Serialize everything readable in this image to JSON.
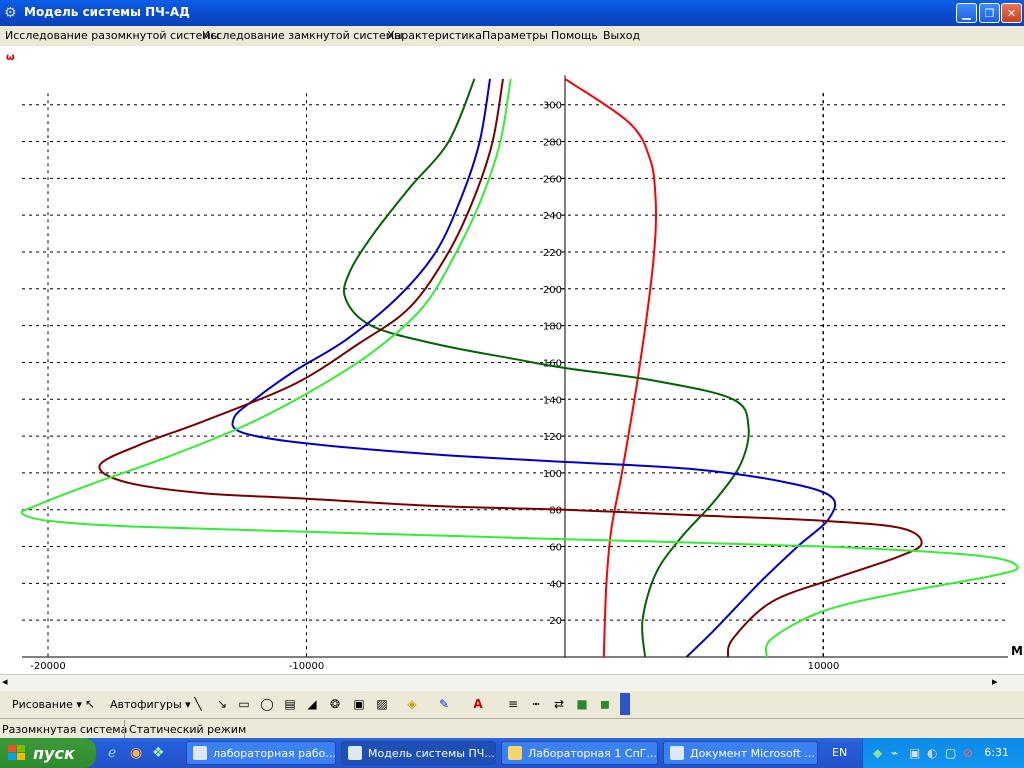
{
  "window": {
    "title": "Модель системы ПЧ-АД",
    "icon": "gear-icon"
  },
  "menu": [
    "Исследование разомкнутой системы",
    "Исследование замкнутой системы",
    "Характеристика",
    "Параметры",
    "Помощь",
    "Выход"
  ],
  "chart_data": {
    "type": "line",
    "ylabel": "ω",
    "xlabel": "M",
    "x_ticks": [
      "-20000",
      "-10000",
      "10000"
    ],
    "y_ticks": [
      "300",
      "280",
      "260",
      "240",
      "220",
      "200",
      "180",
      "160",
      "140",
      "120",
      "100",
      "80",
      "60",
      "40",
      "20"
    ],
    "xlim": [
      -21000,
      17500
    ],
    "ylim": [
      0,
      316
    ],
    "grid": true,
    "series": [
      {
        "color": "#ff0000",
        "points": [
          [
            0,
            314
          ],
          [
            2500,
            290
          ],
          [
            3300,
            270
          ],
          [
            3500,
            250
          ],
          [
            3500,
            230
          ],
          [
            3300,
            200
          ],
          [
            2800,
            150
          ],
          [
            2200,
            100
          ],
          [
            1800,
            70
          ],
          [
            1600,
            40
          ],
          [
            1500,
            0
          ]
        ]
      },
      {
        "color": "#006400",
        "points": [
          [
            -3500,
            314
          ],
          [
            -4500,
            280
          ],
          [
            -6000,
            255
          ],
          [
            -7400,
            230
          ],
          [
            -8300,
            210
          ],
          [
            -8500,
            195
          ],
          [
            -7500,
            180
          ],
          [
            -5000,
            170
          ],
          [
            -2000,
            162
          ],
          [
            0,
            157
          ],
          [
            3500,
            150
          ],
          [
            6500,
            140
          ],
          [
            7100,
            125
          ],
          [
            6800,
            105
          ],
          [
            5800,
            85
          ],
          [
            4500,
            65
          ],
          [
            3500,
            45
          ],
          [
            3000,
            20
          ],
          [
            3100,
            0
          ]
        ]
      },
      {
        "color": "#0000cc",
        "points": [
          [
            -2900,
            314
          ],
          [
            -3300,
            280
          ],
          [
            -4000,
            250
          ],
          [
            -5000,
            220
          ],
          [
            -6500,
            195
          ],
          [
            -8500,
            172
          ],
          [
            -10500,
            155
          ],
          [
            -12000,
            140
          ],
          [
            -12800,
            130
          ],
          [
            -12500,
            122
          ],
          [
            -10000,
            116
          ],
          [
            -5000,
            110
          ],
          [
            0,
            106
          ],
          [
            5000,
            102
          ],
          [
            8500,
            95
          ],
          [
            10300,
            87
          ],
          [
            10200,
            75
          ],
          [
            9000,
            60
          ],
          [
            7500,
            40
          ],
          [
            5800,
            15
          ],
          [
            4700,
            0
          ]
        ]
      },
      {
        "color": "#7a0000",
        "points": [
          [
            -2400,
            314
          ],
          [
            -2800,
            280
          ],
          [
            -3500,
            250
          ],
          [
            -4500,
            220
          ],
          [
            -6000,
            190
          ],
          [
            -8000,
            170
          ],
          [
            -10500,
            148
          ],
          [
            -14000,
            128
          ],
          [
            -16500,
            115
          ],
          [
            -18000,
            104
          ],
          [
            -17000,
            95
          ],
          [
            -14000,
            89
          ],
          [
            -10000,
            86
          ],
          [
            -5000,
            82
          ],
          [
            0,
            80
          ],
          [
            5000,
            77
          ],
          [
            10000,
            74
          ],
          [
            13000,
            70
          ],
          [
            13800,
            62
          ],
          [
            13000,
            55
          ],
          [
            10500,
            43
          ],
          [
            8000,
            30
          ],
          [
            6500,
            10
          ],
          [
            6300,
            0
          ]
        ]
      },
      {
        "color": "#33ee33",
        "points": [
          [
            -2100,
            314
          ],
          [
            -2500,
            280
          ],
          [
            -3200,
            250
          ],
          [
            -4200,
            220
          ],
          [
            -5500,
            190
          ],
          [
            -7500,
            165
          ],
          [
            -10000,
            143
          ],
          [
            -12500,
            125
          ],
          [
            -15500,
            108
          ],
          [
            -18500,
            93
          ],
          [
            -20500,
            82
          ],
          [
            -21000,
            78
          ],
          [
            -20000,
            74
          ],
          [
            -17000,
            71
          ],
          [
            -10000,
            68
          ],
          [
            0,
            64
          ],
          [
            10000,
            60
          ],
          [
            16000,
            55
          ],
          [
            17500,
            49
          ],
          [
            16500,
            44
          ],
          [
            13000,
            35
          ],
          [
            10000,
            25
          ],
          [
            8000,
            10
          ],
          [
            7800,
            0
          ]
        ]
      }
    ]
  },
  "hscroll": {
    "left_arrow": "◂",
    "right_arrow": "▸"
  },
  "drawing_toolbar": {
    "draw_label": "Рисование ▾",
    "autoshapes_label": "Автофигуры ▾"
  },
  "status": {
    "left": "Разомкнутая система",
    "right": "Статический режим"
  },
  "taskbar": {
    "start_label": "пуск",
    "tasks": [
      {
        "label": "лабораторная рабо...",
        "active": false
      },
      {
        "label": "Модель системы ПЧ...",
        "active": true
      },
      {
        "label": "Лабораторная 1 СпГ...",
        "active": false
      },
      {
        "label": "Документ Microsoft ...",
        "active": false
      }
    ],
    "lang": "EN",
    "clock": "6:31"
  }
}
